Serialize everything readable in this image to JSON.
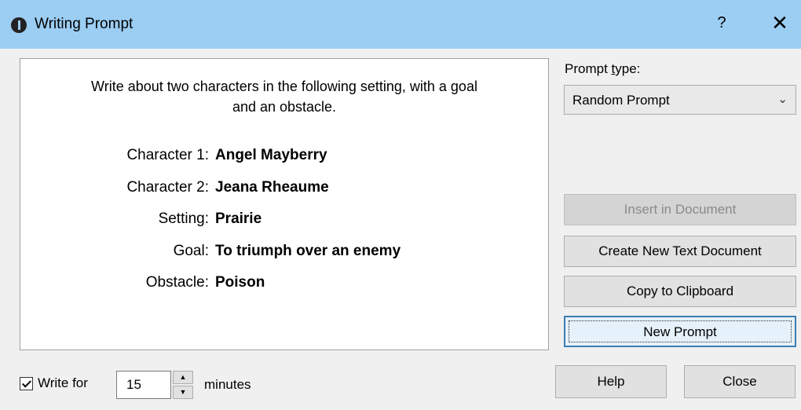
{
  "window": {
    "title": "Writing Prompt",
    "help_glyph": "?",
    "close_glyph": "✕"
  },
  "prompt": {
    "intro_line1": "Write about two characters in the following setting, with a goal",
    "intro_line2": "and an obstacle.",
    "fields": [
      {
        "label": "Character 1:",
        "value": "Angel Mayberry"
      },
      {
        "label": "Character 2:",
        "value": "Jeana Rheaume"
      },
      {
        "label": "Setting:",
        "value": "Prairie"
      },
      {
        "label": "Goal:",
        "value": "To triumph over an enemy"
      },
      {
        "label": "Obstacle:",
        "value": "Poison"
      }
    ]
  },
  "side": {
    "prompt_type_label_pre": "Prompt ",
    "prompt_type_label_u": "t",
    "prompt_type_label_post": "ype:",
    "prompt_type_value": "Random Prompt",
    "insert_label": "Insert in Document",
    "create_label": "Create New Text Document",
    "copy_label": "Copy to Clipboard",
    "new_prompt_label": "New Prompt"
  },
  "bottom": {
    "write_for_label": "Write for",
    "write_for_checked": true,
    "minutes_value": "15",
    "minutes_label": "minutes",
    "help_label": "Help",
    "close_label": "Close"
  },
  "colors": {
    "titlebar": "#9ccdf3",
    "default_button_border": "#3c7fb1"
  }
}
